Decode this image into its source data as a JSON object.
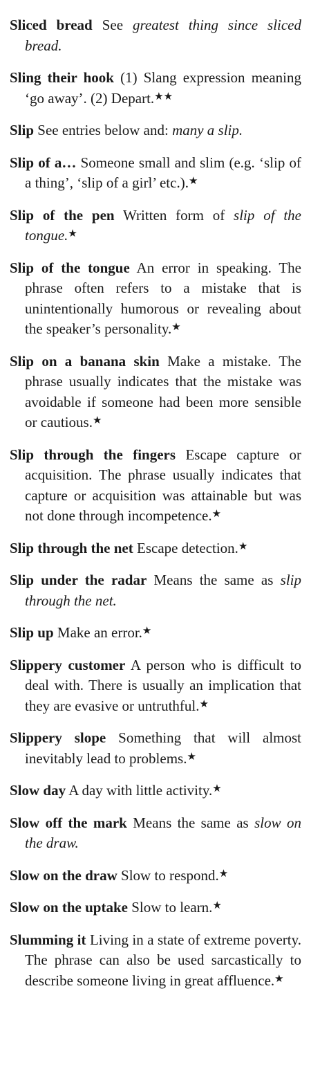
{
  "entries": [
    {
      "term": "Sliced bread",
      "parts": [
        {
          "t": "See "
        },
        {
          "t": "greatest thing since sliced bread.",
          "i": true
        }
      ]
    },
    {
      "term": "Sling their hook",
      "parts": [
        {
          "t": "(1) Slang expression meaning ‘go away’. (2) Depart."
        }
      ],
      "stars": "★★"
    },
    {
      "term": "Slip",
      "parts": [
        {
          "t": "See entries below and: "
        },
        {
          "t": "many a slip.",
          "i": true
        }
      ]
    },
    {
      "term": "Slip of a…",
      "parts": [
        {
          "t": "Someone small and slim (e.g. ‘slip of a thing’, ‘slip of a girl’ etc.)."
        }
      ],
      "stars": "★"
    },
    {
      "term": "Slip of the pen",
      "parts": [
        {
          "t": "Written form of "
        },
        {
          "t": "slip of the tongue.",
          "i": true
        }
      ],
      "stars": "★"
    },
    {
      "term": "Slip of the tongue",
      "parts": [
        {
          "t": "An error in speaking. The phrase often refers to a mistake that is unintentionally humorous or revealing about the speaker’s personality."
        }
      ],
      "stars": "★"
    },
    {
      "term": "Slip on a banana skin",
      "parts": [
        {
          "t": "Make a mistake. The phrase usually indicates that the mistake was avoidable if someone had been more sensible or cautious."
        }
      ],
      "stars": "★"
    },
    {
      "term": "Slip through the fingers",
      "parts": [
        {
          "t": "Escape capture or acquisition. The phrase usually indi­cates that capture or acquisition was attainable but was not done through incompetence."
        }
      ],
      "stars": "★"
    },
    {
      "term": "Slip through the net",
      "parts": [
        {
          "t": "Escape detection."
        }
      ],
      "stars": "★"
    },
    {
      "term": "Slip under the radar",
      "parts": [
        {
          "t": "Means the same as "
        },
        {
          "t": "slip through the net.",
          "i": true
        }
      ]
    },
    {
      "term": "Slip up",
      "parts": [
        {
          "t": "Make an error."
        }
      ],
      "stars": "★"
    },
    {
      "term": "Slippery customer",
      "parts": [
        {
          "t": "A person who is diffi­cult to deal with. There is usually an implication that they are evasive or untruthful."
        }
      ],
      "stars": "★"
    },
    {
      "term": "Slippery slope",
      "parts": [
        {
          "t": "Something that will almost inevitably lead to problems."
        }
      ],
      "stars": "★"
    },
    {
      "term": "Slow day",
      "parts": [
        {
          "t": "A day with little activity."
        }
      ],
      "stars": "★"
    },
    {
      "term": "Slow off the mark",
      "parts": [
        {
          "t": "Means the same as "
        },
        {
          "t": "slow on the draw.",
          "i": true
        }
      ]
    },
    {
      "term": "Slow on the draw",
      "parts": [
        {
          "t": "Slow to respond."
        }
      ],
      "stars": "★"
    },
    {
      "term": "Slow on the uptake",
      "parts": [
        {
          "t": "Slow to learn."
        }
      ],
      "stars": "★"
    },
    {
      "term": "Slumming it",
      "parts": [
        {
          "t": "Living in a state of extreme poverty. The phrase can also be used sar­castically to describe someone living in great affluence."
        }
      ],
      "stars": "★"
    }
  ]
}
